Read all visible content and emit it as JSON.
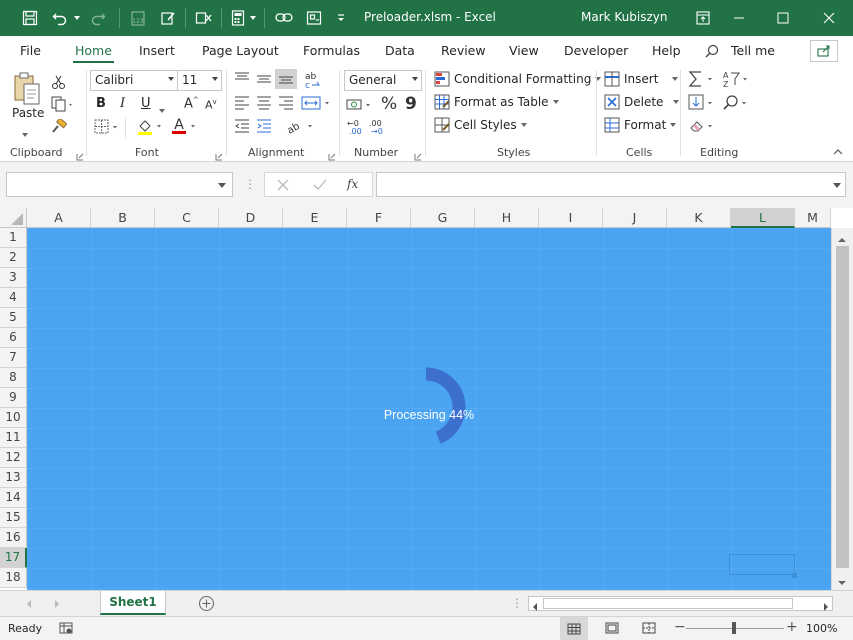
{
  "titlebar": {
    "title": "Preloader.xlsm  -  Excel",
    "user": "Mark Kubiszyn",
    "bg_color": "#217346"
  },
  "tabs": [
    "File",
    "Home",
    "Insert",
    "Page Layout",
    "Formulas",
    "Data",
    "Review",
    "View",
    "Developer",
    "Help"
  ],
  "tell_me": "Tell me",
  "ribbon": {
    "clipboard": {
      "paste": "Paste",
      "label": "Clipboard"
    },
    "font": {
      "name": "Calibri",
      "size": "11",
      "bold": "B",
      "italic": "I",
      "underline": "U",
      "label": "Font"
    },
    "alignment": {
      "label": "Alignment"
    },
    "number": {
      "format": "General",
      "percent": "%",
      "comma": "9",
      "label": "Number"
    },
    "styles": {
      "conditional": "Conditional Formatting",
      "table": "Format as Table",
      "cell": "Cell Styles",
      "label": "Styles"
    },
    "cells": {
      "insert": "Insert",
      "delete": "Delete",
      "format": "Format",
      "label": "Cells"
    },
    "editing": {
      "label": "Editing"
    }
  },
  "formula_bar": {
    "fx": "fx",
    "value": ""
  },
  "columns": [
    "A",
    "B",
    "C",
    "D",
    "E",
    "F",
    "G",
    "H",
    "I",
    "J",
    "K",
    "L",
    "M"
  ],
  "rows": [
    "1",
    "2",
    "3",
    "4",
    "5",
    "6",
    "7",
    "8",
    "9",
    "10",
    "11",
    "12",
    "13",
    "14",
    "15",
    "16",
    "17",
    "18"
  ],
  "overlay": {
    "text": "Processing 44%",
    "progress": 44,
    "bg_color": "#4aa4f2",
    "ring_color": "#3d6fcf"
  },
  "sheet_tab": "Sheet1",
  "status": {
    "ready": "Ready",
    "zoom": "100%"
  }
}
